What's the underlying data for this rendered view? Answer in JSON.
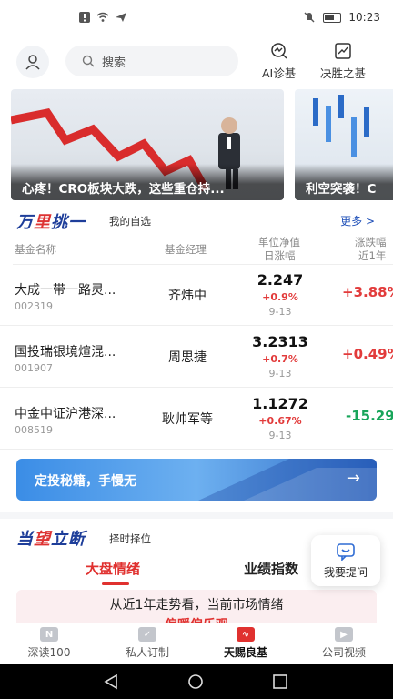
{
  "status_bar": {
    "time": "10:23"
  },
  "header": {
    "search_placeholder": "搜索",
    "ai_label": "AI诊基",
    "win_label": "决胜之基"
  },
  "banners": [
    {
      "caption": "心疼！CRO板块大跌，这些重仓持..."
    },
    {
      "caption": "利空突袭！C"
    }
  ],
  "section_picks": {
    "brand_a": "万",
    "brand_hl": "里",
    "brand_b": "挑一",
    "subtitle": "我的自选",
    "more": "更多 >",
    "columns": {
      "name": "基金名称",
      "manager": "基金经理",
      "nav_line1": "单位净值",
      "nav_line2": "日涨幅",
      "change_line1": "涨跌幅",
      "change_line2": "近1年"
    },
    "funds": [
      {
        "name": "大成一带一路灵...",
        "code": "002319",
        "manager": "齐炜中",
        "nav": "2.247",
        "day_change": "+0.9%",
        "date": "9-13",
        "year_change": "+3.88%"
      },
      {
        "name": "国投瑞银境煊混...",
        "code": "001907",
        "manager": "周思捷",
        "nav": "3.2313",
        "day_change": "+0.7%",
        "date": "9-13",
        "year_change": "+0.49%"
      },
      {
        "name": "中金中证沪港深...",
        "code": "008519",
        "manager": "耿帅军等",
        "nav": "1.1272",
        "day_change": "+0.67%",
        "date": "9-13",
        "year_change": "-15.29%"
      }
    ]
  },
  "promo": {
    "text": "定投秘籍，手慢无",
    "arrow": "→"
  },
  "section_timing": {
    "brand_a": "当",
    "brand_hl": "望",
    "brand_b": "立断",
    "subtitle": "择时择位",
    "tabs": [
      "大盘情绪",
      "业绩指数"
    ],
    "mood_line1": "从近1年走势看，当前市场情绪",
    "mood_line2": "偏暖偏乐观"
  },
  "float_button": {
    "label": "我要提问"
  },
  "bottom_nav": [
    {
      "label": "深读100",
      "active": false
    },
    {
      "label": "私人订制",
      "active": false
    },
    {
      "label": "天赐良基",
      "active": true
    },
    {
      "label": "公司视频",
      "active": false
    }
  ],
  "colors": {
    "up": "#e23b3b",
    "down": "#18a55a",
    "accent": "#e0312f",
    "brand": "#1e3e9a"
  }
}
